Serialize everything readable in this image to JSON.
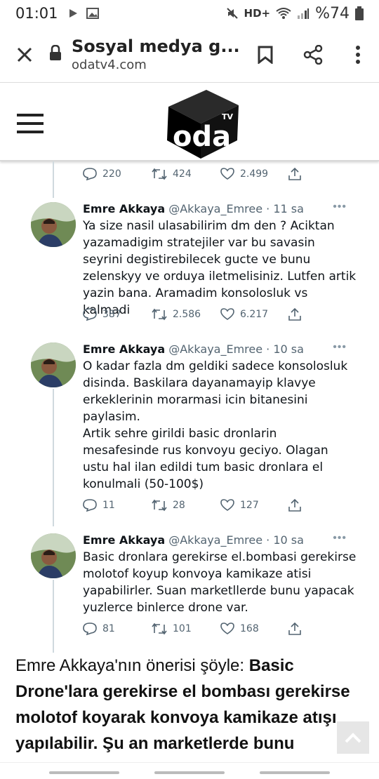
{
  "status": {
    "time": "01:01",
    "net": "HD+",
    "battery": "%74"
  },
  "browser": {
    "title": "Sosyal medya g...",
    "domain": "odatv4.com"
  },
  "site": {
    "logo_text": "oda",
    "logo_sup": "TV"
  },
  "first_actions": {
    "replies": "220",
    "retweets": "424",
    "likes": "2.499"
  },
  "tweets": [
    {
      "name": "Emre Akkaya",
      "handle": "@Akkaya_Emree · 11 sa",
      "text": "Ya size nasil ulasabilirim dm den ? Aciktan yazamadigim stratejiler var bu savasin seyrini degistirebilecek gucte ve bunu zelenskyy ve orduya iletmelisiniz. Lutfen artik yazin bana. Aramadim konsolosluk vs kalmadi",
      "replies": "387",
      "retweets": "2.586",
      "likes": "6.217"
    },
    {
      "name": "Emre Akkaya",
      "handle": "@Akkaya_Emree · 10 sa",
      "text": "O kadar fazla dm geldiki sadece konsolosluk disinda. Baskilara dayanamayip klavye erkeklerinin morarmasi icin bitanesini paylasim.\nArtik sehre girildi basic dronlarin mesafesinde rus konvoyu geciyo. Olagan ustu hal ilan edildi tum basic dronlara el konulmali (50-100$)",
      "replies": "11",
      "retweets": "28",
      "likes": "127"
    },
    {
      "name": "Emre Akkaya",
      "handle": "@Akkaya_Emree · 10 sa",
      "text": "Basic dronlara gerekirse el.bombasi gerekirse molotof koyup konvoya kamikaze atisi yapabilirler. Suan marketllerde bunu yapacak yuzlerce binlerce drone var.",
      "replies": "81",
      "retweets": "101",
      "likes": "168"
    }
  ],
  "article": {
    "intro": "Emre Akkaya'nın önerisi şöyle: ",
    "bold": "Basic Drone'lara gerekirse el bombası gerekirse molotof koyarak konvoya kamikaze atışı yapılabilir. Şu an marketlerde bunu"
  }
}
